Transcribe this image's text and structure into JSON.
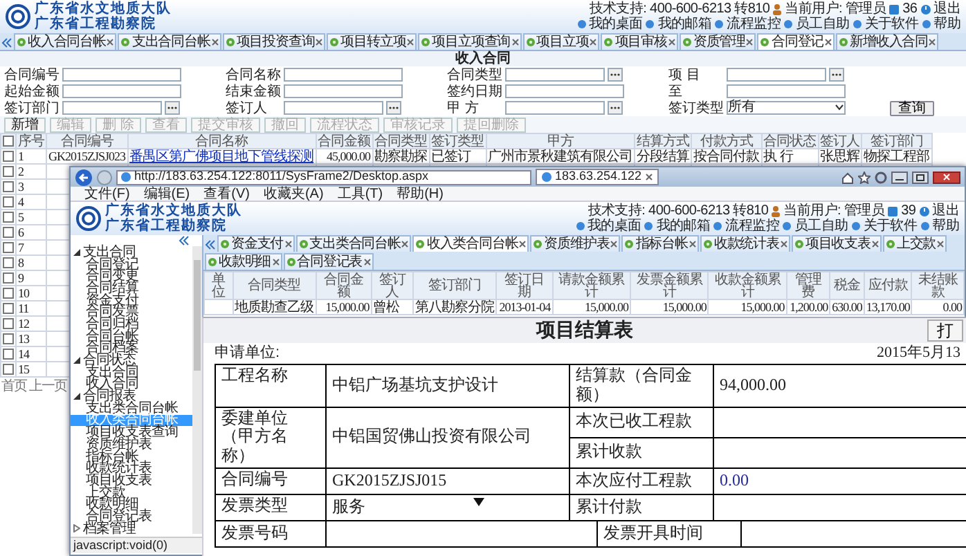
{
  "back_window": {
    "header": {
      "logo_lines": [
        "广东省水文地质大队",
        "广东省工程勘察院"
      ],
      "support": "技术支持: 400-600-6213 转810",
      "user": "当前用户: 管理员",
      "message_count": "36",
      "logout": "退出",
      "links": [
        "我的桌面",
        "我的邮箱",
        "流程监控",
        "员工自助",
        "关于软件",
        "帮助"
      ]
    },
    "tabs": [
      {
        "label": "收入合同台帐",
        "selected": false
      },
      {
        "label": "支出合同台帐",
        "selected": false
      },
      {
        "label": "项目投资查询",
        "selected": false
      },
      {
        "label": "项目转立项",
        "selected": false
      },
      {
        "label": "项目立项查询",
        "selected": false
      },
      {
        "label": "项目立项",
        "selected": false
      },
      {
        "label": "项目审核",
        "selected": false
      },
      {
        "label": "资质管理",
        "selected": false
      },
      {
        "label": "合同登记",
        "selected": true
      },
      {
        "label": "新增收入合同",
        "selected": false
      }
    ],
    "page_title": "收入合同",
    "search_fields": [
      {
        "label": "合同编号",
        "kind": "text"
      },
      {
        "label": "合同名称",
        "kind": "text"
      },
      {
        "label": "合同类型",
        "kind": "picker"
      },
      {
        "label": "项 目",
        "kind": "picker"
      },
      {
        "label": "起始金额",
        "kind": "text"
      },
      {
        "label": "结束金额",
        "kind": "text"
      },
      {
        "label": "签约日期",
        "kind": "text"
      },
      {
        "label": "至",
        "kind": "text"
      },
      {
        "label": "签订部门",
        "kind": "picker"
      },
      {
        "label": "签订人",
        "kind": "picker"
      },
      {
        "label": "甲 方",
        "kind": "picker"
      },
      {
        "label": "签订类型",
        "kind": "select",
        "value": "所有"
      }
    ],
    "search_button": "查询",
    "toolbar": [
      {
        "label": "新增",
        "disabled": false
      },
      {
        "label": "编辑",
        "disabled": true
      },
      {
        "label": "删 除",
        "disabled": true
      },
      {
        "label": "查看",
        "disabled": true
      },
      {
        "label": "提交审核",
        "disabled": true
      },
      {
        "label": "撤回",
        "disabled": true
      },
      {
        "label": "流程状态",
        "disabled": true
      },
      {
        "label": "审核记录",
        "disabled": true
      },
      {
        "label": "提回删除",
        "disabled": true
      }
    ],
    "table": {
      "all_checked": false,
      "columns": [
        "序号",
        "合同编号",
        "合同名称",
        "合同金额",
        "合同类型",
        "签订类型",
        "甲方",
        "结算方式",
        "付款方式",
        "合同状态",
        "签订人",
        "签订部门"
      ],
      "rows": [
        {
          "checked": false,
          "cells": [
            "1",
            "GK2015ZJSJ023",
            "番禺区第广佛项目地下管线探测",
            "45,000.00",
            "勘察勘探",
            "已签订",
            "广州市景秋建筑有限公司",
            "分段结算",
            "按合同付款",
            "执 行",
            "张思辉",
            "物探工程部"
          ]
        },
        {
          "checked": false,
          "cells": [
            "2"
          ]
        },
        {
          "checked": false,
          "cells": [
            "3"
          ]
        },
        {
          "checked": false,
          "cells": [
            "4"
          ]
        },
        {
          "checked": false,
          "cells": [
            "5"
          ]
        },
        {
          "checked": false,
          "cells": [
            "6"
          ]
        },
        {
          "checked": false,
          "cells": [
            "7"
          ]
        },
        {
          "checked": false,
          "cells": [
            "8"
          ]
        },
        {
          "checked": false,
          "cells": [
            "9"
          ]
        },
        {
          "checked": false,
          "cells": [
            "10"
          ]
        },
        {
          "checked": false,
          "cells": [
            "11"
          ]
        },
        {
          "checked": false,
          "cells": [
            "12"
          ]
        },
        {
          "checked": false,
          "cells": [
            "13"
          ]
        },
        {
          "checked": false,
          "cells": [
            "14"
          ]
        },
        {
          "checked": false,
          "cells": [
            "15"
          ]
        }
      ]
    },
    "pager": [
      "首页",
      "上一页"
    ]
  },
  "browser": {
    "url": "http://183.63.254.122:8011/SysFrame2/Desktop.aspx",
    "tab_title": "183.63.254.122",
    "menu": [
      "文件(F)",
      "编辑(E)",
      "查看(V)",
      "收藏夹(A)",
      "工具(T)",
      "帮助(H)"
    ],
    "header": {
      "logo_lines": [
        "广东省水文地质大队",
        "广东省工程勘察院"
      ],
      "support": "技术支持: 400-600-6213 转810",
      "user": "当前用户: 管理员",
      "message_count": "39",
      "logout": "退出",
      "links": [
        "我的桌面",
        "我的邮箱",
        "流程监控",
        "员工自助",
        "关于软件",
        "帮助"
      ]
    },
    "sidebar": [
      {
        "label": "支出合同",
        "expanded": true,
        "children": [
          {
            "label": "合同登记",
            "selected": false
          },
          {
            "label": "合同变更",
            "selected": false
          },
          {
            "label": "合同结算",
            "selected": false
          },
          {
            "label": "资金支付",
            "selected": false
          },
          {
            "label": "合同发票",
            "selected": false
          },
          {
            "label": "合同归档",
            "selected": false
          },
          {
            "label": "合同台帐",
            "selected": false
          },
          {
            "label": "合同档案",
            "selected": false
          }
        ]
      },
      {
        "label": "合同状态",
        "expanded": true,
        "children": [
          {
            "label": "支出合同",
            "selected": false
          },
          {
            "label": "收入合同",
            "selected": false
          }
        ]
      },
      {
        "label": "合同报表",
        "expanded": true,
        "children": [
          {
            "label": "支出类合同台帐",
            "selected": false
          },
          {
            "label": "收入类合同台帐",
            "selected": true
          },
          {
            "label": "项目收支表查询",
            "selected": false
          },
          {
            "label": "资质维护表",
            "selected": false
          },
          {
            "label": "指标台帐",
            "selected": false
          },
          {
            "label": "收款统计表",
            "selected": false
          },
          {
            "label": "项目收支表",
            "selected": false
          },
          {
            "label": "上交款",
            "selected": false
          },
          {
            "label": "收款明细",
            "selected": false
          },
          {
            "label": "合同登记表",
            "selected": false
          }
        ]
      },
      {
        "label": "档案管理",
        "expanded": false
      }
    ],
    "status_bar": "javascript:void(0)",
    "tabs": [
      {
        "label": "资金支付",
        "selected": false
      },
      {
        "label": "支出类合同台帐",
        "selected": false
      },
      {
        "label": "收入类合同台帐",
        "selected": true
      },
      {
        "label": "资质维护表",
        "selected": false
      },
      {
        "label": "指标台帐",
        "selected": false
      },
      {
        "label": "收款统计表",
        "selected": false
      },
      {
        "label": "项目收支表",
        "selected": false
      },
      {
        "label": "上交款",
        "selected": false
      },
      {
        "label": "收款明细",
        "selected": false
      },
      {
        "label": "合同登记表",
        "selected": false
      }
    ],
    "table": {
      "columns": [
        "单位",
        "合同类型",
        "合同金额",
        "签订人",
        "签订部门",
        "签订日期",
        "请款金额累计",
        "发票金额累计",
        "收款金额累计",
        "管理费",
        "税金",
        "应付款",
        "未结账款"
      ],
      "rows": [
        [
          "",
          "地质勘查乙级",
          "15,000.00",
          "曾松",
          "第八勘察分院",
          "2013-01-04",
          "15,000.00",
          "15,000.00",
          "15,000.00",
          "1,200.00",
          "630.00",
          "13,170.00",
          "0.00"
        ]
      ]
    }
  },
  "form": {
    "title": "项目结算表",
    "print_button": "打",
    "applicant_label": "申请单位:",
    "date": "2015年5月13",
    "rows": [
      {
        "label": "工程名称",
        "value": "中铝广场基坑支护设计",
        "kind": "text",
        "right": [
          {
            "label": "结算款（合同金额）",
            "value": "94,000.00"
          }
        ]
      },
      {
        "label": "委建单位（甲方名称）",
        "value": "中铝国贸佛山投资有限公司",
        "kind": "text",
        "right": [
          {
            "label": "本次已收工程款"
          },
          {
            "label": "累计收款"
          }
        ]
      },
      {
        "label": "合同编号",
        "value": "GK2015ZJSJ015",
        "kind": "text",
        "right": [
          {
            "label": "本次应付工程款",
            "value": "0.00",
            "kind": "highlight"
          }
        ]
      },
      {
        "label": "发票类型",
        "value": "服务",
        "kind": "select",
        "right": [
          {
            "label": "累计付款"
          }
        ]
      }
    ],
    "invoice_row": [
      {
        "label": "发票号码"
      },
      {
        "label": "发票开具时间"
      }
    ]
  }
}
